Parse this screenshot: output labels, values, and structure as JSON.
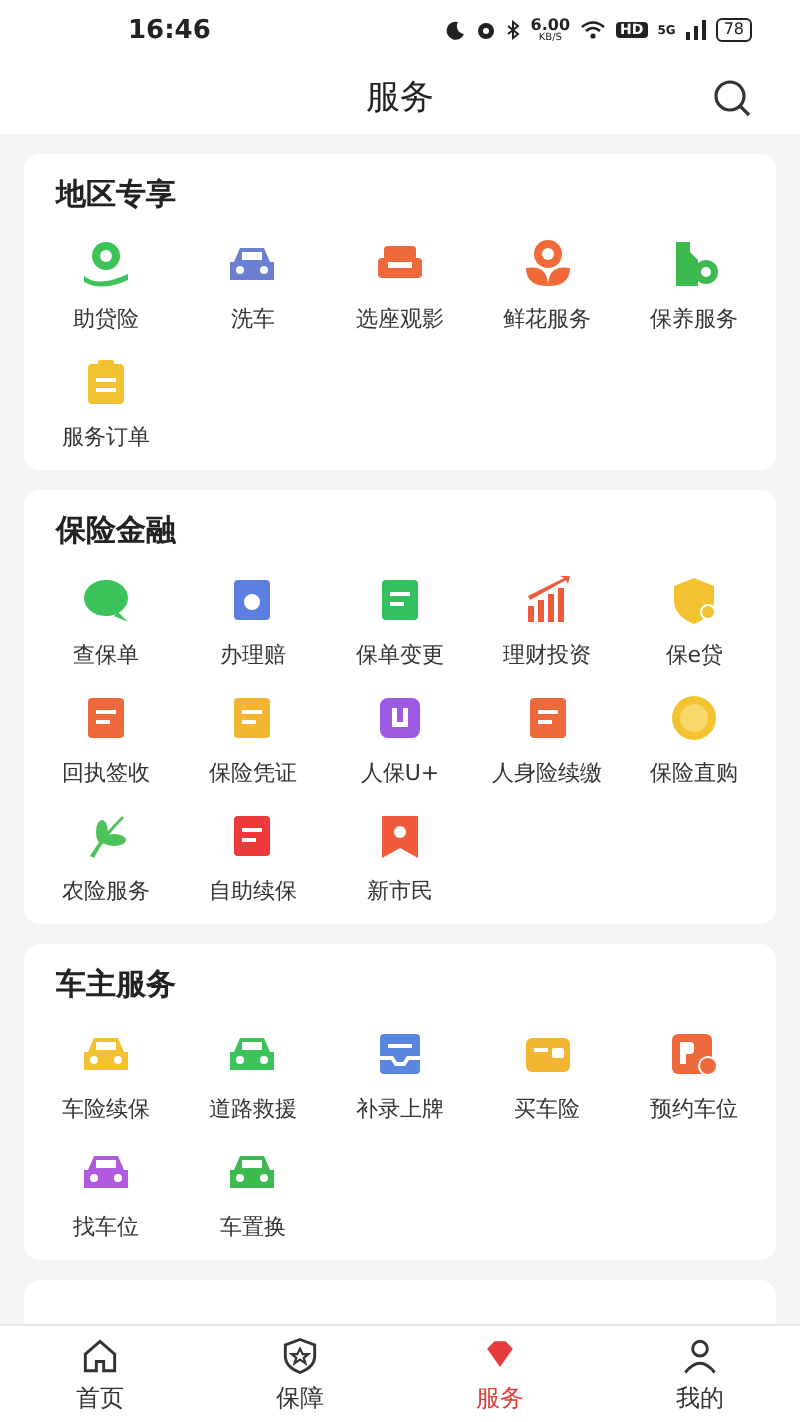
{
  "status_bar": {
    "time": "16:46",
    "speed_value": "6.00",
    "speed_unit": "KB/S",
    "hd": "HD",
    "network": "5G",
    "battery": "78"
  },
  "header": {
    "title": "服务"
  },
  "sections": [
    {
      "title": "地区专享",
      "items": [
        {
          "label": "助贷险"
        },
        {
          "label": "洗车"
        },
        {
          "label": "选座观影"
        },
        {
          "label": "鲜花服务"
        },
        {
          "label": "保养服务"
        },
        {
          "label": "服务订单"
        }
      ]
    },
    {
      "title": "保险金融",
      "items": [
        {
          "label": "查保单"
        },
        {
          "label": "办理赔"
        },
        {
          "label": "保单变更"
        },
        {
          "label": "理财投资"
        },
        {
          "label": "保e贷"
        },
        {
          "label": "回执签收"
        },
        {
          "label": "保险凭证"
        },
        {
          "label": "人保U+"
        },
        {
          "label": "人身险续缴"
        },
        {
          "label": "保险直购"
        },
        {
          "label": "农险服务"
        },
        {
          "label": "自助续保"
        },
        {
          "label": "新市民"
        }
      ]
    },
    {
      "title": "车主服务",
      "items": [
        {
          "label": "车险续保"
        },
        {
          "label": "道路救援"
        },
        {
          "label": "补录上牌"
        },
        {
          "label": "买车险"
        },
        {
          "label": "预约车位"
        },
        {
          "label": "找车位"
        },
        {
          "label": "车置换"
        }
      ]
    }
  ],
  "tab_bar": [
    {
      "label": "首页",
      "selected": false
    },
    {
      "label": "保障",
      "selected": false
    },
    {
      "label": "服务",
      "selected": true
    },
    {
      "label": "我的",
      "selected": false
    }
  ]
}
